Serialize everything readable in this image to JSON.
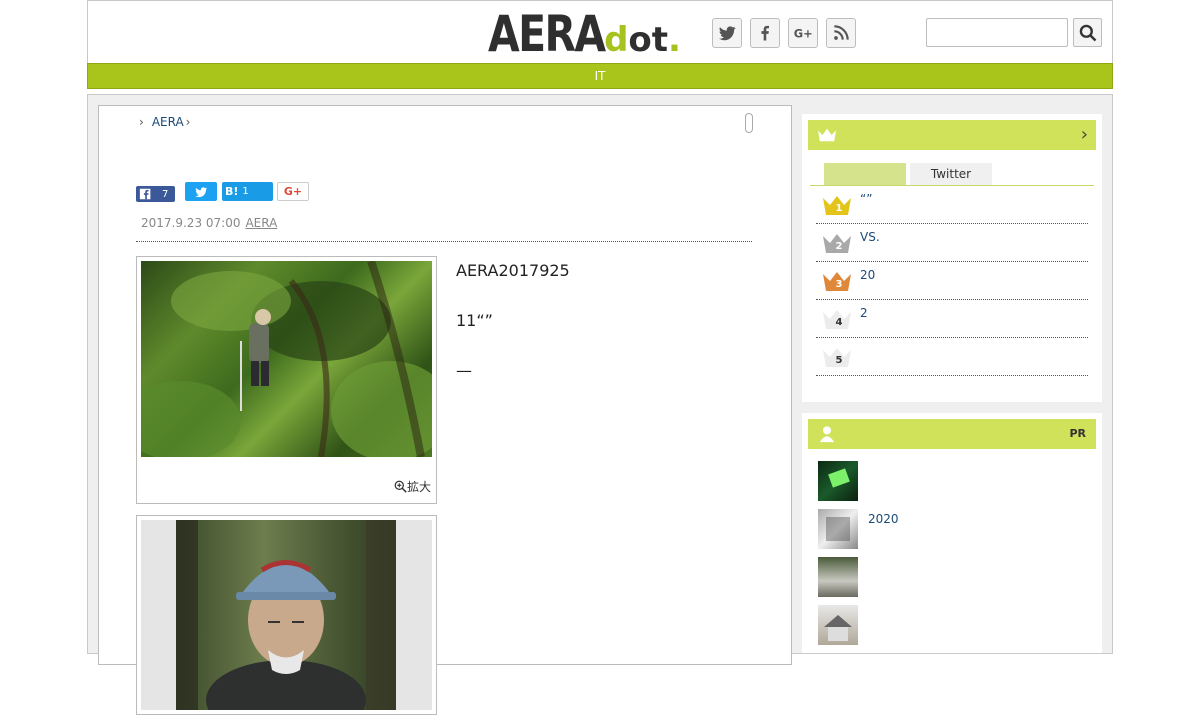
{
  "header": {
    "logo_main": "AERA",
    "logo_sub_d": "d",
    "logo_sub_rest": "ot",
    "logo_sub_period": ".",
    "social": [
      "twitter-icon",
      "facebook-icon",
      "google-plus-icon",
      "rss-icon"
    ],
    "search": {
      "value": "",
      "placeholder": ""
    }
  },
  "nav": {
    "label": "IT"
  },
  "colors": {
    "brand_green": "#a9c41a",
    "sidebar_head": "#cfe25a",
    "link": "#1a4a7a"
  },
  "article": {
    "breadcrumb": [
      "AERA"
    ],
    "share": {
      "facebook_count": "7",
      "hatena_label": "B!",
      "hatena_count": "1",
      "gplus_label": "G+"
    },
    "date": "2017.9.23 07:00",
    "author": "AERA",
    "zoom_label": "拡大",
    "paragraphs": [
      "AERA2017925",
      "11“”",
      "—",
      ""
    ]
  },
  "ranking": {
    "tabs": [
      "",
      "Twitter"
    ],
    "items": [
      {
        "rank": "1",
        "text": "“”"
      },
      {
        "rank": "2",
        "text": "VS."
      },
      {
        "rank": "3",
        "text": "20"
      },
      {
        "rank": "4",
        "text": "2"
      },
      {
        "rank": "5",
        "text": ""
      }
    ]
  },
  "pr": {
    "label": "PR",
    "items": [
      {
        "text": ""
      },
      {
        "text": "2020"
      },
      {
        "text": ""
      },
      {
        "text": ""
      }
    ]
  }
}
